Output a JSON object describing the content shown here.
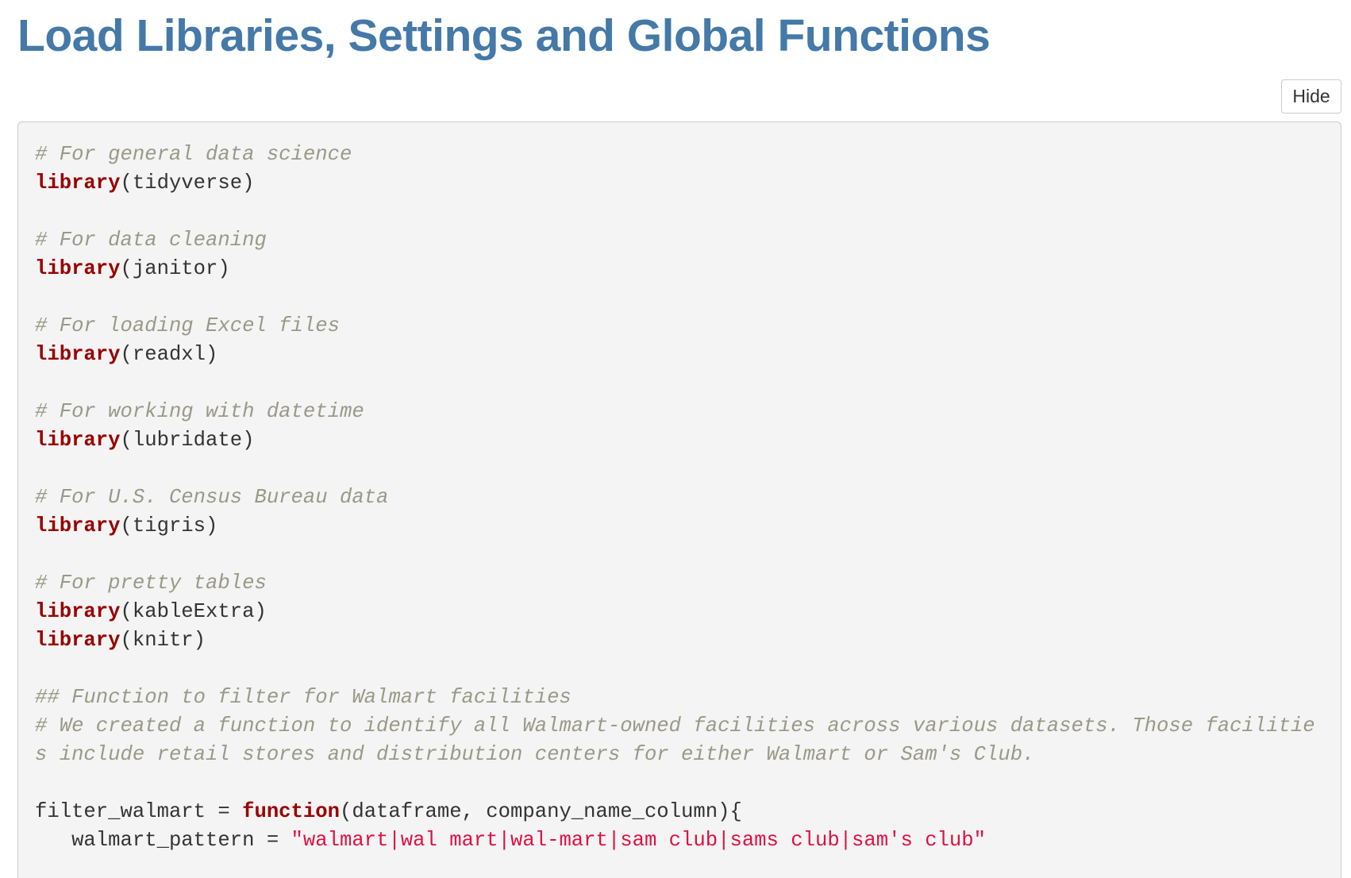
{
  "page": {
    "title": "Load Libraries, Settings and Global Functions"
  },
  "code_toggle": {
    "label": "Hide"
  },
  "code_block": {
    "lines": [
      [
        {
          "t": "comment",
          "v": "# For general data science"
        }
      ],
      [
        {
          "t": "keyword",
          "v": "library"
        },
        {
          "t": "plain",
          "v": "(tidyverse)"
        }
      ],
      [],
      [
        {
          "t": "comment",
          "v": "# For data cleaning"
        }
      ],
      [
        {
          "t": "keyword",
          "v": "library"
        },
        {
          "t": "plain",
          "v": "(janitor)"
        }
      ],
      [],
      [
        {
          "t": "comment",
          "v": "# For loading Excel files"
        }
      ],
      [
        {
          "t": "keyword",
          "v": "library"
        },
        {
          "t": "plain",
          "v": "(readxl)"
        }
      ],
      [],
      [
        {
          "t": "comment",
          "v": "# For working with datetime"
        }
      ],
      [
        {
          "t": "keyword",
          "v": "library"
        },
        {
          "t": "plain",
          "v": "(lubridate)"
        }
      ],
      [],
      [
        {
          "t": "comment",
          "v": "# For U.S. Census Bureau data"
        }
      ],
      [
        {
          "t": "keyword",
          "v": "library"
        },
        {
          "t": "plain",
          "v": "(tigris)"
        }
      ],
      [],
      [
        {
          "t": "comment",
          "v": "# For pretty tables"
        }
      ],
      [
        {
          "t": "keyword",
          "v": "library"
        },
        {
          "t": "plain",
          "v": "(kableExtra)"
        }
      ],
      [
        {
          "t": "keyword",
          "v": "library"
        },
        {
          "t": "plain",
          "v": "(knitr)"
        }
      ],
      [],
      [
        {
          "t": "comment",
          "v": "## Function to filter for Walmart facilities"
        }
      ],
      [
        {
          "t": "comment",
          "v": "# We created a function to identify all Walmart-owned facilities across various datasets. Those facilities include retail stores and distribution centers for either Walmart or Sam's Club."
        }
      ],
      [],
      [
        {
          "t": "plain",
          "v": "filter_walmart = "
        },
        {
          "t": "keyword",
          "v": "function"
        },
        {
          "t": "plain",
          "v": "(dataframe, company_name_column){"
        }
      ],
      [
        {
          "t": "plain",
          "v": "   walmart_pattern = "
        },
        {
          "t": "string",
          "v": "\"walmart|wal mart|wal-mart|sam club|sams club|sam's club\""
        }
      ]
    ]
  }
}
